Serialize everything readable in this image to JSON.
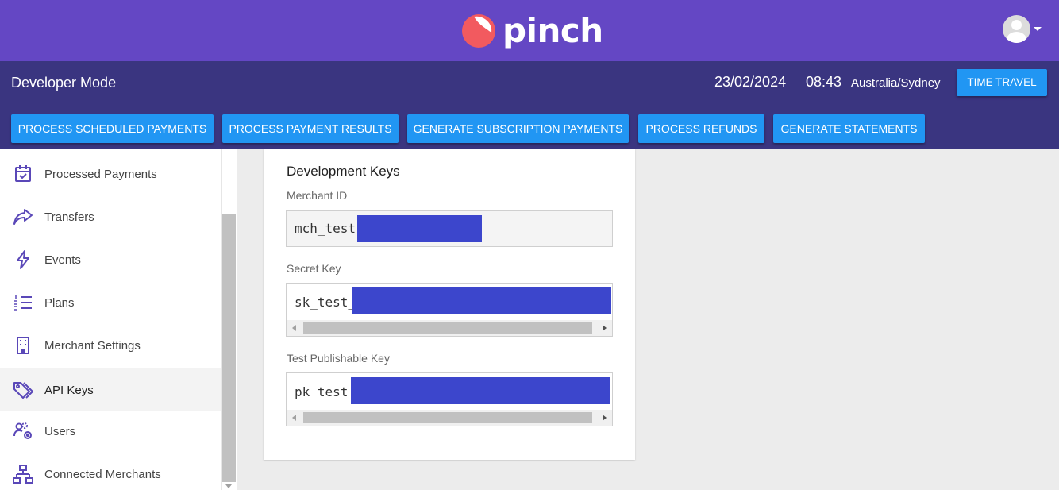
{
  "brand": {
    "name": "pinch",
    "header_color": "#6447c4",
    "logo_color": "#f25a5f",
    "accent": "#2196f3"
  },
  "user_menu": {
    "avatar_icon": "user-avatar-icon",
    "caret_icon": "caret-down-icon"
  },
  "developer_bar": {
    "title": "Developer Mode",
    "date": "23/02/2024",
    "time": "08:43",
    "timezone": "Australia/Sydney",
    "time_travel_label": "TIME TRAVEL",
    "actions": [
      "PROCESS SCHEDULED PAYMENTS",
      "PROCESS PAYMENT RESULTS",
      "GENERATE SUBSCRIPTION PAYMENTS",
      "PROCESS REFUNDS",
      "GENERATE STATEMENTS"
    ]
  },
  "sidebar": {
    "icon_color": "#5a48b8",
    "items": [
      {
        "label": "Processed Payments",
        "icon": "calendar-check-icon",
        "active": false
      },
      {
        "label": "Transfers",
        "icon": "share-arrow-icon",
        "active": false
      },
      {
        "label": "Events",
        "icon": "lightning-icon",
        "active": false
      },
      {
        "label": "Plans",
        "icon": "numbered-list-icon",
        "active": false
      },
      {
        "label": "Merchant Settings",
        "icon": "building-icon",
        "active": false
      },
      {
        "label": "API Keys",
        "icon": "tags-icon",
        "active": true
      },
      {
        "label": "Users",
        "icon": "users-gear-icon",
        "active": false
      },
      {
        "label": "Connected Merchants",
        "icon": "sitemap-icon",
        "active": false
      }
    ]
  },
  "keys_card": {
    "title": "Development Keys",
    "merchant_id_label": "Merchant ID",
    "merchant_id_value": "mch_test",
    "secret_key_label": "Secret Key",
    "secret_key_value": "sk_test_",
    "publishable_key_label": "Test Publishable Key",
    "publishable_key_value": "pk_test_",
    "redaction_color": "#3c46cc"
  }
}
